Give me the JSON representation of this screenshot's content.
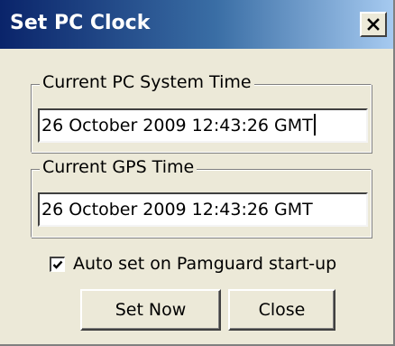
{
  "window": {
    "title": "Set PC Clock",
    "close_icon": "close-x-icon"
  },
  "pc_time": {
    "label": "Current PC System Time",
    "value": "26 October 2009 12:43:26 GMT"
  },
  "gps_time": {
    "label": "Current GPS Time",
    "value": "26 October 2009 12:43:26 GMT"
  },
  "auto_set": {
    "label": "Auto set on Pamguard start-up",
    "checked": true,
    "icon": "checkmark-icon"
  },
  "buttons": {
    "set_now": "Set Now",
    "close": "Close"
  }
}
